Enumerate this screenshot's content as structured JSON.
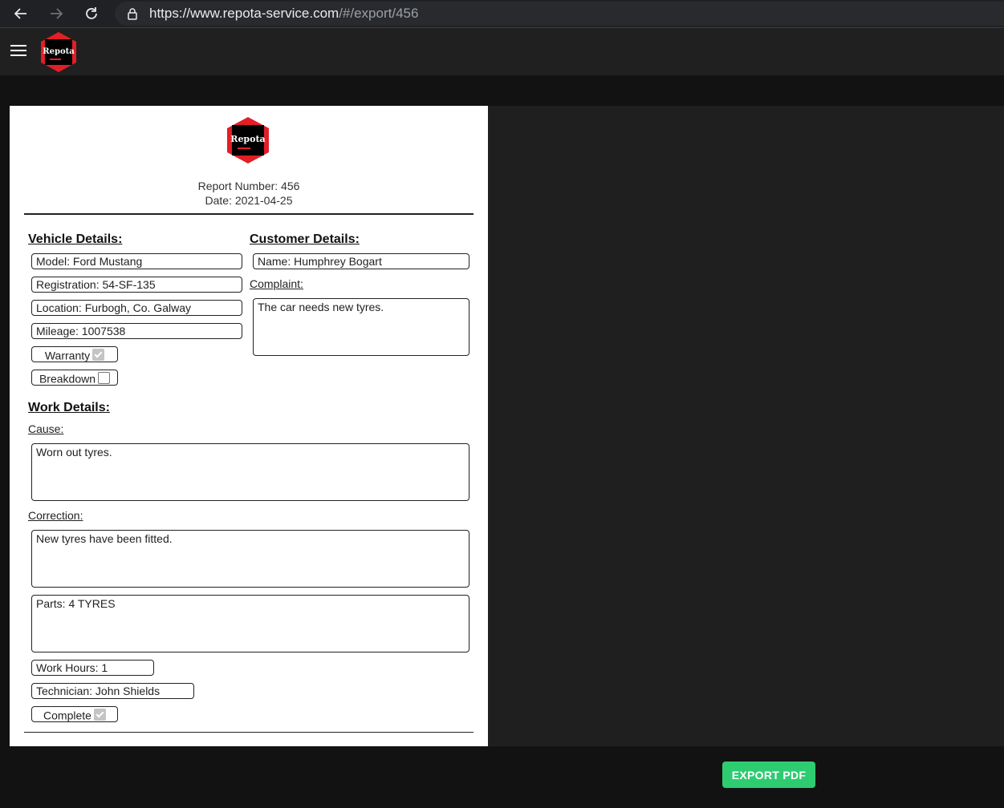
{
  "browser": {
    "url_host": "https://www.repota-service.com",
    "url_path": "/#/export/456"
  },
  "app": {
    "logo_text": "Repota"
  },
  "report": {
    "logo_text": "Repota",
    "report_number": "Report Number: 456",
    "date": "Date: 2021-04-25",
    "vehicle": {
      "title": "Vehicle Details:",
      "model": "Model: Ford Mustang",
      "registration": "Registration: 54-SF-135",
      "location": "Location: Furbogh, Co. Galway",
      "mileage": "Mileage: 1007538",
      "warranty_label": "Warranty",
      "warranty_checked": true,
      "breakdown_label": "Breakdown",
      "breakdown_checked": false
    },
    "customer": {
      "title": "Customer Details:",
      "name": "Name: Humphrey Bogart",
      "complaint_label": "Complaint:",
      "complaint": "The car needs new tyres."
    },
    "work": {
      "title": "Work Details:",
      "cause_label": "Cause:",
      "cause": "Worn out tyres.",
      "correction_label": "Correction:",
      "correction": "New tyres have been fitted.",
      "parts": "Parts: 4 TYRES",
      "work_hours": "Work Hours: 1",
      "technician": "Technician: John Shields",
      "complete_label": "Complete",
      "complete_checked": true
    }
  },
  "actions": {
    "export_label": "EXPORT PDF"
  },
  "colors": {
    "export_button": "#2ecc71",
    "logo_red": "#e21f26"
  }
}
